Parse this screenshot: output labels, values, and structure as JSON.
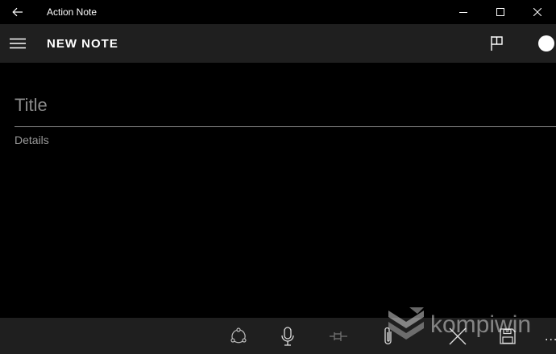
{
  "window": {
    "title": "Action Note",
    "back_icon": "back-arrow-icon",
    "minimize_icon": "minimize-icon",
    "maximize_icon": "maximize-icon",
    "close_icon": "close-icon"
  },
  "header": {
    "title": "NEW NOTE",
    "menu_icon": "hamburger-menu-icon",
    "flag_icon": "flag-icon",
    "color_icon": "color-dot-icon"
  },
  "note": {
    "title_placeholder": "Title",
    "details_placeholder": "Details",
    "title_value": "",
    "details_value": ""
  },
  "appbar": {
    "buttons": [
      "share-icon",
      "microphone-icon",
      "pin-icon",
      "attach-icon",
      "discard-icon",
      "save-icon"
    ],
    "more_label": "..."
  },
  "watermark": {
    "text": "kompiwin"
  },
  "colors": {
    "background": "#000000",
    "bar": "#1f1f1f",
    "placeholder": "#8a8a8a"
  }
}
